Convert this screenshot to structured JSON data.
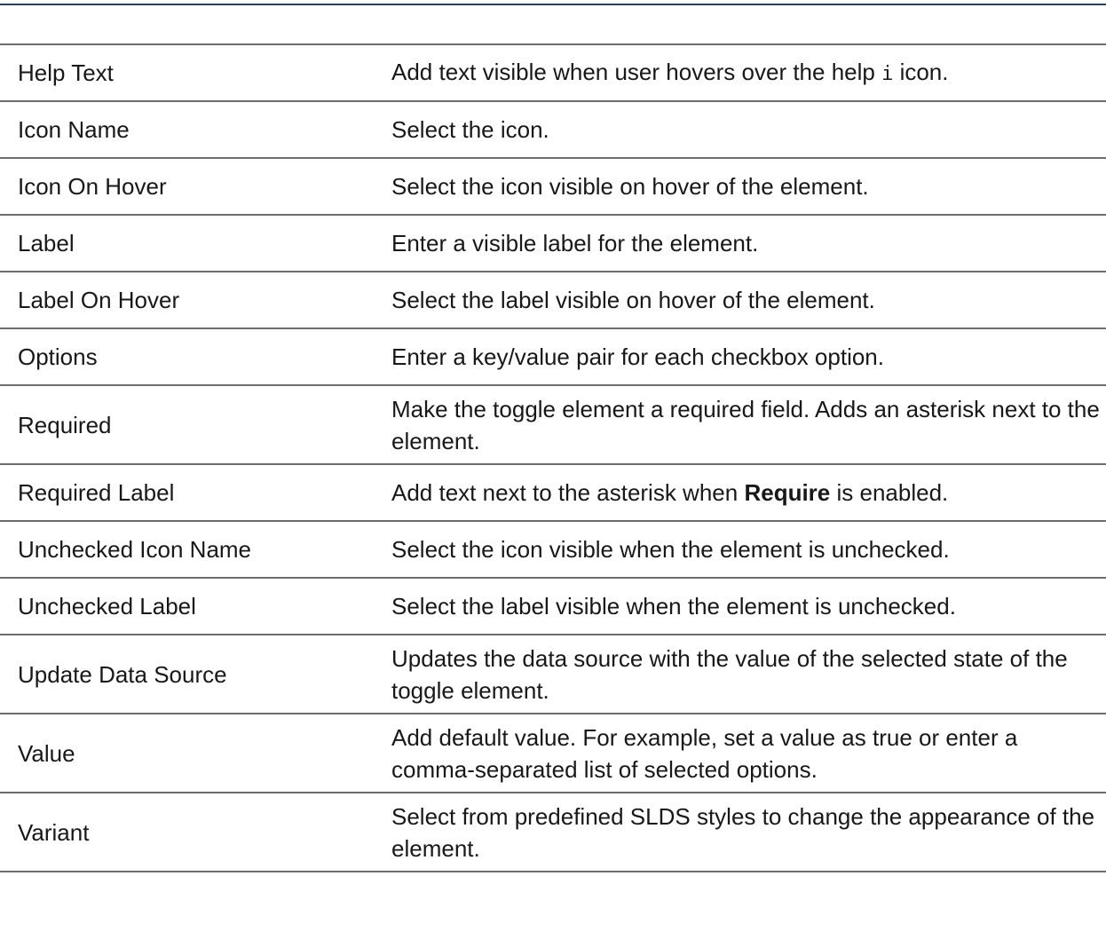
{
  "rows": [
    {
      "property": "Help Text",
      "description_before": "Add text visible when user hovers over the help ",
      "description_code": "i",
      "description_after": " icon."
    },
    {
      "property": "Icon Name",
      "description": "Select the icon."
    },
    {
      "property": "Icon On Hover",
      "description": "Select the icon visible on hover of the element."
    },
    {
      "property": "Label",
      "description": "Enter a visible label for the element."
    },
    {
      "property": "Label On Hover",
      "description": "Select the label visible on hover of the element."
    },
    {
      "property": "Options",
      "description": "Enter a key/value pair for each checkbox option."
    },
    {
      "property": "Required",
      "description": "Make the toggle element a required field. Adds an asterisk next to the element."
    },
    {
      "property": "Required Label",
      "description_before": "Add text next to the asterisk when ",
      "description_bold": "Require",
      "description_after": " is enabled."
    },
    {
      "property": "Unchecked Icon Name",
      "description": "Select the icon visible when the element is unchecked."
    },
    {
      "property": "Unchecked Label",
      "description": "Select the label visible when the element is unchecked."
    },
    {
      "property": "Update Data Source",
      "description": "Updates the data source with the value of the selected state of the toggle element."
    },
    {
      "property": "Value",
      "description": "Add default value. For example, set a value as true or enter a comma-separated list of selected options."
    },
    {
      "property": "Variant",
      "description": "Select from predefined SLDS styles to change the appearance of the element."
    }
  ]
}
